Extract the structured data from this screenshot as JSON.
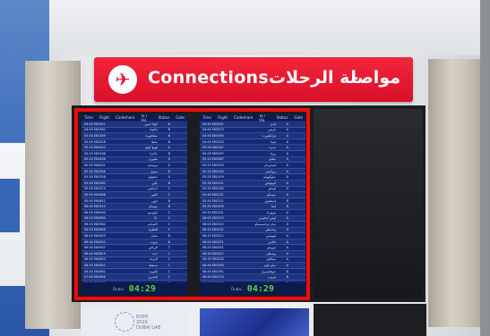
{
  "sign": {
    "title_en": "Connections",
    "separator": "-",
    "title_ar": "مواصلة الرحلات",
    "icon": "airplane-icon"
  },
  "boards": [
    {
      "headers": [
        "Time",
        "Flight",
        "Codeshare",
        "To / Via",
        "Status",
        "Gate"
      ],
      "clock": "04:29",
      "footer_label": "Dubai",
      "rows": [
        {
          "flight": "04:45 EK0501",
          "city": "كوالا لمبور",
          "gate": "B"
        },
        {
          "flight": "04:50 EK0381",
          "city": "بانكوك",
          "gate": "B"
        },
        {
          "flight": "05:00 EK0349",
          "city": "سنغافورة",
          "gate": "B"
        },
        {
          "flight": "05:05 EK0318",
          "city": "مانيلا",
          "gate": "B"
        },
        {
          "flight": "05:10 EK0402",
          "city": "هونغ كونغ",
          "gate": "A"
        },
        {
          "flight": "05:15 EK0336",
          "city": "جاكرتا",
          "gate": "B"
        },
        {
          "flight": "05:20 EK0406",
          "city": "ملبورن",
          "gate": "A"
        },
        {
          "flight": "05:25 EK0431",
          "city": "بريسبان",
          "gate": "A"
        },
        {
          "flight": "05:30 EK0348",
          "city": "سيول",
          "gate": "B"
        },
        {
          "flight": "05:35 EK0326",
          "city": "شنغهاي",
          "gate": "A"
        },
        {
          "flight": "05:40 EK0362",
          "city": "بكين",
          "gate": "B"
        },
        {
          "flight": "05:45 EK0374",
          "city": "كراتشي",
          "gate": "C"
        },
        {
          "flight": "05:50 EK0606",
          "city": "لاهور",
          "gate": "C"
        },
        {
          "flight": "05:55 EK0622",
          "city": "دلهي",
          "gate": "B"
        },
        {
          "flight": "06:00 EK0510",
          "city": "مومباي",
          "gate": "B"
        },
        {
          "flight": "06:05 EK0500",
          "city": "كولومبو",
          "gate": "C"
        },
        {
          "flight": "06:10 EK0650",
          "city": "دكا",
          "gate": "C"
        },
        {
          "flight": "06:15 EK0582",
          "city": "كاتماندو",
          "gate": "C"
        },
        {
          "flight": "06:20 EK0648",
          "city": "القاهرة",
          "gate": "C"
        },
        {
          "flight": "06:25 EK0923",
          "city": "عمان",
          "gate": "B"
        },
        {
          "flight": "06:30 EK0903",
          "city": "بيروت",
          "gate": "B"
        },
        {
          "flight": "06:35 EK0957",
          "city": "الرياض",
          "gate": "C"
        },
        {
          "flight": "06:40 EK0819",
          "city": "جدة",
          "gate": "C"
        },
        {
          "flight": "06:45 EK0803",
          "city": "الدوحة",
          "gate": "C"
        },
        {
          "flight": "06:50 EK0841",
          "city": "مسقط",
          "gate": "C"
        },
        {
          "flight": "06:55 EK0862",
          "city": "الكويت",
          "gate": "C"
        },
        {
          "flight": "07:00 EK0856",
          "city": "البحرين",
          "gate": "C"
        },
        {
          "flight": "07:05 EK0839",
          "city": "الدمام",
          "gate": "C"
        },
        {
          "flight": "07:10 EK0817",
          "city": "المدينة",
          "gate": "C"
        },
        {
          "flight": "07:15 EK0971",
          "city": "طهران",
          "gate": "C"
        },
        {
          "flight": "07:20 EK0975",
          "city": "أصفهان",
          "gate": "C"
        },
        {
          "flight": "07:25 EK0943",
          "city": "بغداد",
          "gate": "C"
        }
      ]
    },
    {
      "headers": [
        "Time",
        "Flight",
        "Codeshare",
        "To / Via",
        "Status",
        "Gate"
      ],
      "clock": "04:29",
      "footer_label": "Dubai",
      "rows": [
        {
          "flight": "04:40 EK0001",
          "city": "لندن",
          "gate": "A"
        },
        {
          "flight": "04:45 EK0073",
          "city": "باريس",
          "gate": "A"
        },
        {
          "flight": "04:50 EK0045",
          "city": "فرانكفورت",
          "gate": "A"
        },
        {
          "flight": "04:55 EK0125",
          "city": "فيينا",
          "gate": "A"
        },
        {
          "flight": "05:00 EK0147",
          "city": "مدريد",
          "gate": "A"
        },
        {
          "flight": "05:05 EK0097",
          "city": "روما",
          "gate": "A"
        },
        {
          "flight": "05:10 EK0087",
          "city": "ميلانو",
          "gate": "A"
        },
        {
          "flight": "05:15 EK0149",
          "city": "أمستردام",
          "gate": "A"
        },
        {
          "flight": "05:20 EK0183",
          "city": "بروكسل",
          "gate": "A"
        },
        {
          "flight": "05:25 EK0159",
          "city": "ستوكهولم",
          "gate": "A"
        },
        {
          "flight": "05:30 EK0151",
          "city": "كوبنهاغن",
          "gate": "A"
        },
        {
          "flight": "05:35 EK0165",
          "city": "أوسلو",
          "gate": "A"
        },
        {
          "flight": "05:40 EK0131",
          "city": "موسكو",
          "gate": "A"
        },
        {
          "flight": "05:45 EK0121",
          "city": "إسطنبول",
          "gate": "B"
        },
        {
          "flight": "05:50 EK0209",
          "city": "أثينا",
          "gate": "B"
        },
        {
          "flight": "05:55 EK0201",
          "city": "نيويورك",
          "gate": "A"
        },
        {
          "flight": "06:00 EK0215",
          "city": "لوس أنجلوس",
          "gate": "A"
        },
        {
          "flight": "06:05 EK0225",
          "city": "سان فرانسيسكو",
          "gate": "A"
        },
        {
          "flight": "06:10 EK0231",
          "city": "واشنطن",
          "gate": "A"
        },
        {
          "flight": "06:15 EK0211",
          "city": "هيوستن",
          "gate": "A"
        },
        {
          "flight": "06:20 EK0221",
          "city": "دالاس",
          "gate": "A"
        },
        {
          "flight": "06:25 EK0241",
          "city": "تورونتو",
          "gate": "A"
        },
        {
          "flight": "06:30 EK0247",
          "city": "بوسطن",
          "gate": "A"
        },
        {
          "flight": "06:35 EK0235",
          "city": "شيكاغو",
          "gate": "A"
        },
        {
          "flight": "06:40 EK0263",
          "city": "ساو باولو",
          "gate": "A"
        },
        {
          "flight": "06:45 EK0761",
          "city": "جوهانسبرغ",
          "gate": "B"
        },
        {
          "flight": "06:50 EK0719",
          "city": "نيروبي",
          "gate": "B"
        },
        {
          "flight": "06:55 EK0723",
          "city": "أديس أبابا",
          "gate": "B"
        },
        {
          "flight": "07:00 EK0751",
          "city": "لاغوس",
          "gate": "B"
        },
        {
          "flight": "07:05 EK0787",
          "city": "أكرا",
          "gate": "B"
        },
        {
          "flight": "07:10 EK0795",
          "city": "الدار البيضاء",
          "gate": "B"
        },
        {
          "flight": "07:15 EK0751",
          "city": "تونس",
          "gate": "B"
        }
      ]
    }
  ],
  "ads": {
    "expo_line1": "EXPO",
    "expo_line2": "2020",
    "expo_line3": "DUBAI UAE"
  }
}
